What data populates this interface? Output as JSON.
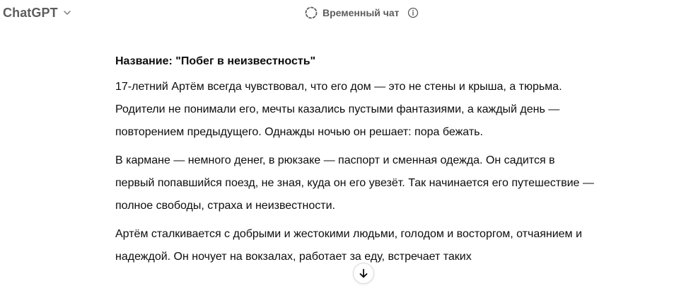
{
  "header": {
    "model_name": "ChatGPT",
    "temporary_chat_label": "Временный чат",
    "icons": {
      "model_dropdown": "chevron-down-icon",
      "temporary_chat": "dashed-circle-icon",
      "info": "info-icon"
    }
  },
  "message": {
    "title": "Название: \"Побег в неизвестность\"",
    "paragraphs": [
      "17-летний Артём всегда чувствовал, что его дом — это не стены и крыша, а тюрьма. Родители не понимали его, мечты казались пустыми фантазиями, а каждый день — повторением предыдущего. Однажды ночью он решает: пора бежать.",
      "В кармане — немного денег, в рюкзаке — паспорт и сменная одежда. Он садится в первый попавшийся поезд, не зная, куда он его увезёт. Так начинается его путешествие — полное свободы, страха и неизвестности.",
      "Артём сталкивается с добрыми и жестокими людьми, голодом и восторгом, отчаянием и надеждой. Он ночует на вокзалах, работает за еду, встречает таких"
    ]
  },
  "scroll_button": {
    "icon": "arrow-down-icon"
  },
  "colors": {
    "header_text": "#5d5d5d",
    "body_text": "#0d0d0d",
    "background": "#ffffff"
  }
}
